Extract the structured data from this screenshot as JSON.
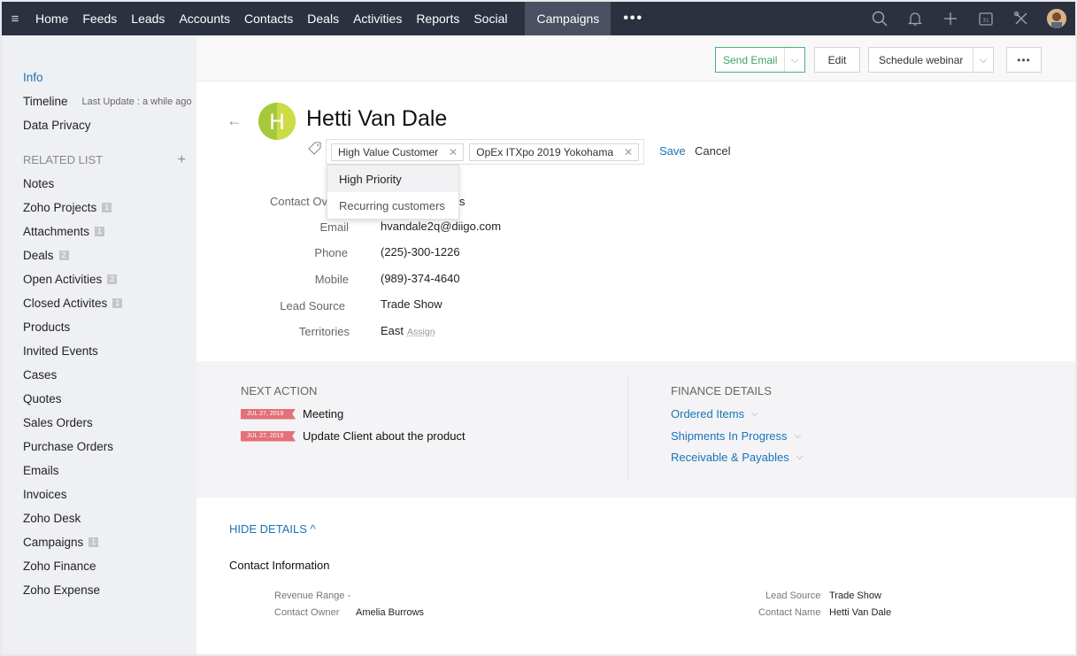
{
  "nav": {
    "items": [
      "Home",
      "Feeds",
      "Leads",
      "Accounts",
      "Contacts",
      "Deals",
      "Activities",
      "Reports",
      "Social"
    ],
    "active": "Campaigns",
    "more": "•••"
  },
  "sidebar": {
    "info": "Info",
    "timeline": "Timeline",
    "timeline_meta": "Last Update : a while ago",
    "data_privacy": "Data Privacy",
    "related_list": "RELATED LIST",
    "items": [
      {
        "label": "Notes",
        "badge": ""
      },
      {
        "label": "Zoho Projects",
        "badge": "1"
      },
      {
        "label": "Attachments",
        "badge": "1"
      },
      {
        "label": "Deals",
        "badge": "2"
      },
      {
        "label": "Open Activities",
        "badge": "2"
      },
      {
        "label": "Closed Activites",
        "badge": "1"
      },
      {
        "label": "Products",
        "badge": ""
      },
      {
        "label": "Invited Events",
        "badge": ""
      },
      {
        "label": "Cases",
        "badge": ""
      },
      {
        "label": "Quotes",
        "badge": ""
      },
      {
        "label": "Sales Orders",
        "badge": ""
      },
      {
        "label": "Purchase Orders",
        "badge": ""
      },
      {
        "label": "Emails",
        "badge": ""
      },
      {
        "label": "Invoices",
        "badge": ""
      },
      {
        "label": "Zoho Desk",
        "badge": ""
      },
      {
        "label": "Campaigns",
        "badge": "1"
      },
      {
        "label": "Zoho Finance",
        "badge": ""
      },
      {
        "label": "Zoho Expense",
        "badge": ""
      }
    ]
  },
  "actions": {
    "send_email": "Send Email",
    "edit": "Edit",
    "schedule_webinar": "Schedule webinar",
    "more": "•••"
  },
  "contact": {
    "name": "Hetti Van Dale",
    "avatar_letter": "H",
    "tags": [
      "High Value Customer",
      "OpEx ITXpo 2019 Yokohama"
    ],
    "save": "Save",
    "cancel": "Cancel",
    "dropdown": [
      "High Priority",
      "Recurring customers"
    ]
  },
  "fields": {
    "contact_owner_label": "Contact Ov",
    "contact_owner_value": "s",
    "email_label": "Email",
    "email_value": "hvandale2q@diigo.com",
    "phone_label": "Phone",
    "phone_value": "(225)-300-1226",
    "mobile_label": "Mobile",
    "mobile_value": "(989)-374-4640",
    "lead_source_label": "Lead Source",
    "lead_source_value": "Trade Show",
    "territories_label": "Territories",
    "territories_value": "East",
    "assign": "Assign"
  },
  "next_action": {
    "title": "NEXT ACTION",
    "items": [
      {
        "date": "JUL 27, 2019",
        "text": "Meeting"
      },
      {
        "date": "JUL 27, 2019",
        "text": "Update Client about the product"
      }
    ]
  },
  "finance": {
    "title": "FINANCE DETAILS",
    "links": [
      "Ordered Items",
      "Shipments In Progress",
      "Receivable & Payables"
    ]
  },
  "details": {
    "hide_details": "HIDE DETAILS ^",
    "section_title": "Contact Information",
    "revenue_range_label": "Revenue Range -",
    "contact_owner_label": "Contact Owner",
    "contact_owner_value": "Amelia Burrows",
    "lead_source_label": "Lead Source",
    "lead_source_value": "Trade Show",
    "contact_name_label": "Contact Name",
    "contact_name_value": "Hetti Van Dale"
  }
}
